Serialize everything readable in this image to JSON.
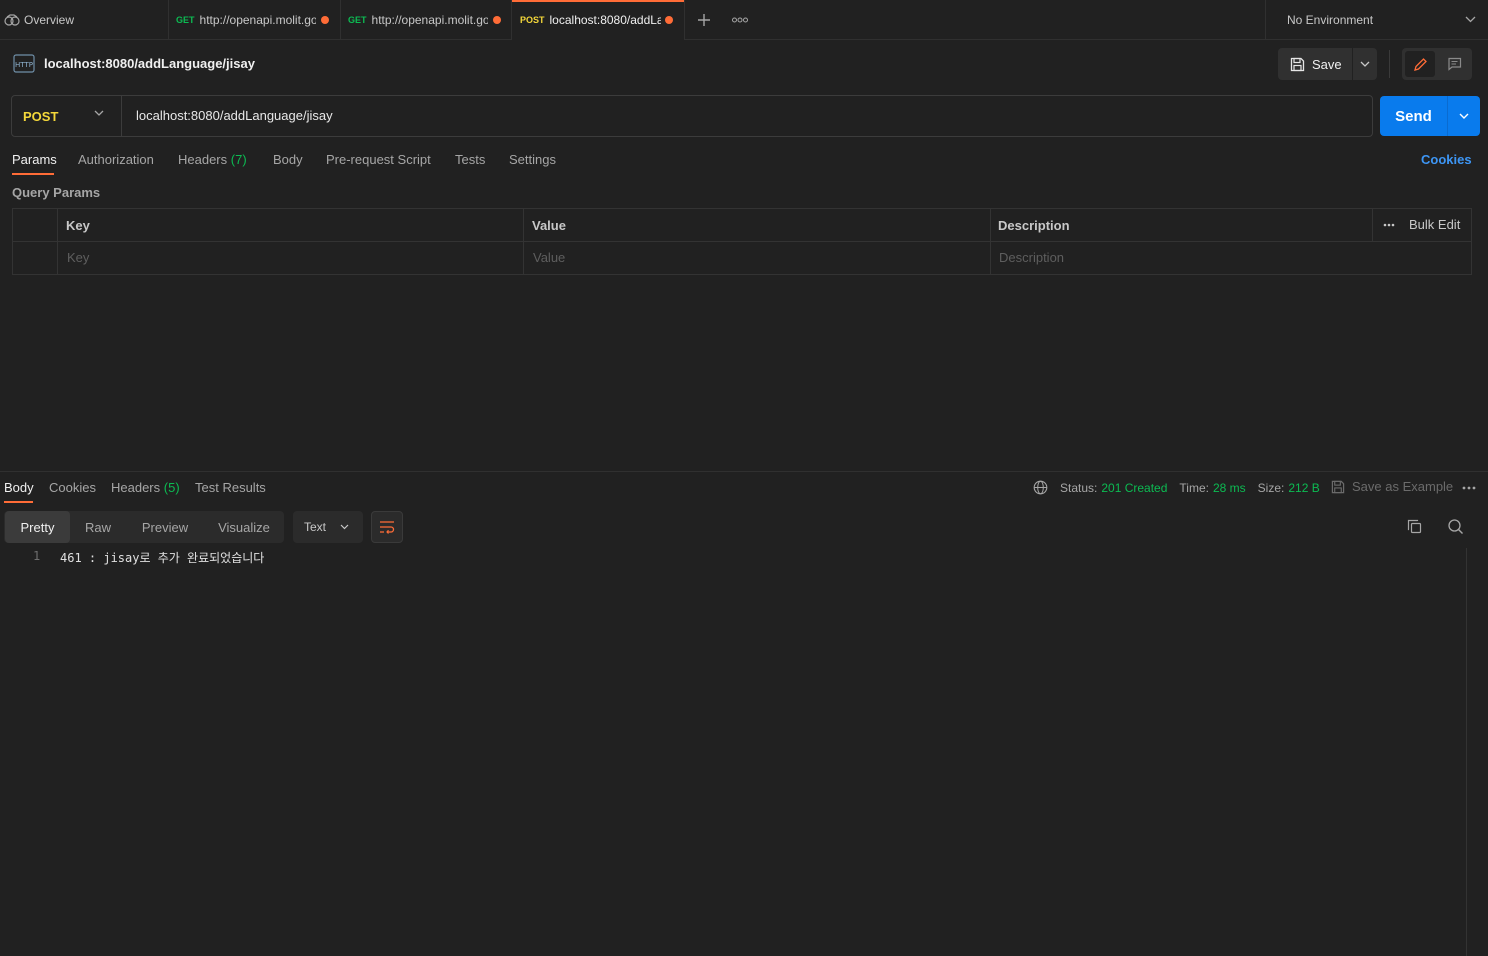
{
  "tabs": {
    "overview": {
      "label": "Overview"
    },
    "items": [
      {
        "method": "GET",
        "url": "http://openapi.molit.go"
      },
      {
        "method": "GET",
        "url": "http://openapi.molit.go"
      },
      {
        "method": "POST",
        "url": "localhost:8080/addLa"
      }
    ],
    "environment": "No Environment"
  },
  "request": {
    "title": "localhost:8080/addLanguage/jisay",
    "save_label": "Save",
    "method": "POST",
    "url": "localhost:8080/addLanguage/jisay",
    "send_label": "Send",
    "tabs": {
      "params": "Params",
      "authorization": "Authorization",
      "headers": "Headers",
      "headers_count": "(7)",
      "body": "Body",
      "prerequest": "Pre-request Script",
      "tests": "Tests",
      "settings": "Settings"
    },
    "cookies_label": "Cookies",
    "query_params_title": "Query Params",
    "table": {
      "headers": {
        "key": "Key",
        "value": "Value",
        "description": "Description"
      },
      "placeholders": {
        "key": "Key",
        "value": "Value",
        "description": "Description"
      },
      "bulk_edit": "Bulk Edit"
    }
  },
  "response": {
    "tabs": {
      "body": "Body",
      "cookies": "Cookies",
      "headers": "Headers",
      "headers_count": "(5)",
      "test_results": "Test Results"
    },
    "status_label": "Status:",
    "status_value": "201 Created",
    "time_label": "Time:",
    "time_value": "28 ms",
    "size_label": "Size:",
    "size_value": "212 B",
    "save_example": "Save as Example",
    "view_modes": [
      "Pretty",
      "Raw",
      "Preview",
      "Visualize"
    ],
    "format": "Text",
    "line_number": "1",
    "body_line": "461 : jisay로 추가 완료되었습니다"
  },
  "colors": {
    "accent": "#ff6c37",
    "send": "#097bed",
    "post_method": "#f5d83a",
    "get_method": "#0cbb52",
    "success": "#0cbb52",
    "link": "#3d96f5"
  }
}
